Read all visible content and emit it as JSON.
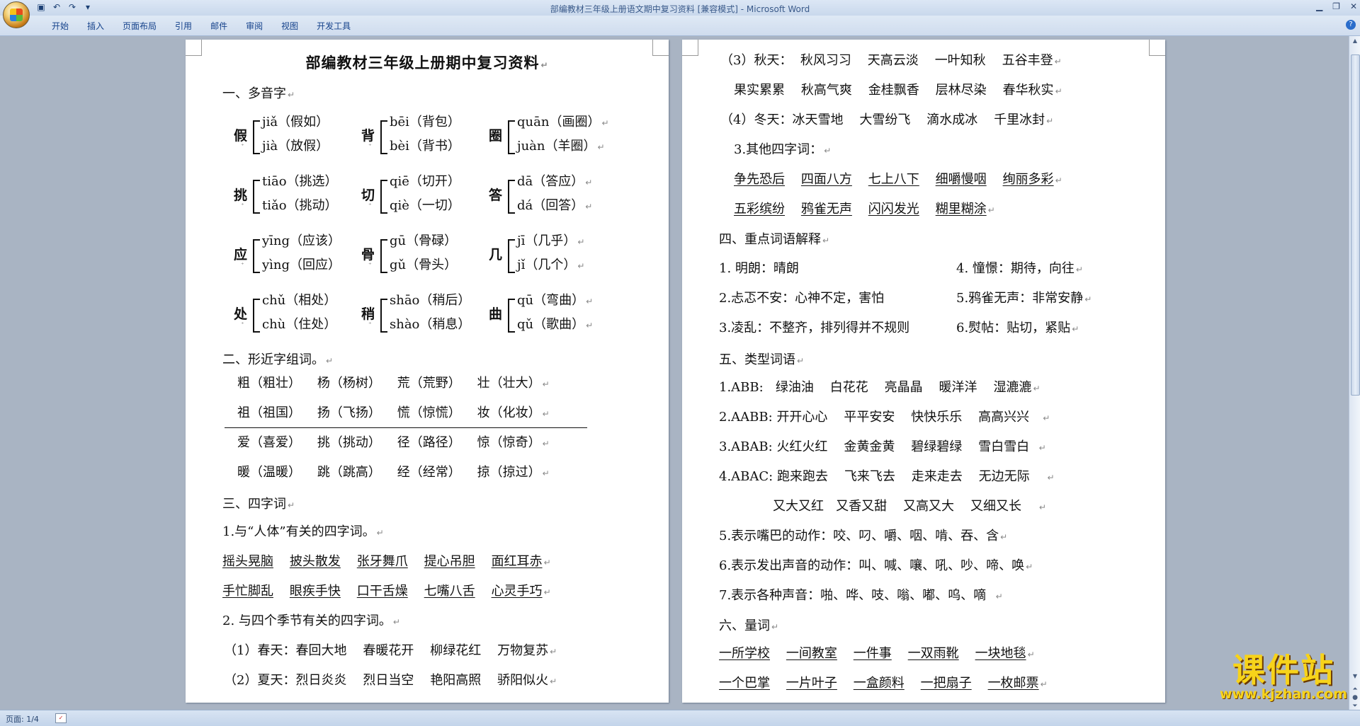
{
  "window": {
    "title": "部编教材三年级上册语文期中复习资料 [兼容模式] - Microsoft Word",
    "controls": [
      "minimize-icon",
      "maximize-icon",
      "close-icon"
    ]
  },
  "quick_access": [
    "save-icon",
    "undo-icon",
    "redo-icon",
    "customize-icon"
  ],
  "ribbon": {
    "tabs": [
      "开始",
      "插入",
      "页面布局",
      "引用",
      "邮件",
      "审阅",
      "视图",
      "开发工具"
    ]
  },
  "status": {
    "page": "页面: 1/4"
  },
  "doc": {
    "title": "部编教材三年级上册期中复习资料",
    "s1": "一、多音字",
    "poly": [
      {
        "ch": "假",
        "r1": "jiǎ（假如）",
        "r2": "jià（放假）"
      },
      {
        "ch": "背",
        "r1": "bēi（背包）",
        "r2": "bèi（背书）"
      },
      {
        "ch": "圈",
        "r1": "quān（画圈）",
        "r2": "juàn（羊圈）"
      },
      {
        "ch": "挑",
        "r1": "tiāo（挑选）",
        "r2": "tiǎo（挑动）"
      },
      {
        "ch": "切",
        "r1": "qiē（切开）",
        "r2": "qiè（一切）"
      },
      {
        "ch": "答",
        "r1": "dā（答应）",
        "r2": "dá（回答）"
      },
      {
        "ch": "应",
        "r1": "yīng（应该）",
        "r2": "yìng（回应）"
      },
      {
        "ch": "骨",
        "r1": "gū（骨碌）",
        "r2": "gǔ（骨头）"
      },
      {
        "ch": "几",
        "r1": "jī（几乎）",
        "r2": "jǐ（几个）"
      },
      {
        "ch": "处",
        "r1": "chǔ（相处）",
        "r2": "chù（住处）"
      },
      {
        "ch": "稍",
        "r1": "shāo（稍后）",
        "r2": "shào（稍息）"
      },
      {
        "ch": "曲",
        "r1": "qū（弯曲）",
        "r2": "qǔ（歌曲）"
      }
    ],
    "s2": "二、形近字组词。",
    "similar": [
      [
        "粗（粗壮）",
        "杨（杨树）",
        "荒（荒野）",
        "壮（壮大）"
      ],
      [
        "祖（祖国）",
        "扬（飞扬）",
        "慌（惊慌）",
        "妆（化妆）"
      ],
      [
        "爱（喜爱）",
        "挑（挑动）",
        "径（路径）",
        "惊（惊奇）"
      ],
      [
        "暖（温暖）",
        "跳（跳高）",
        "经（经常）",
        "掠（掠过）"
      ]
    ],
    "s3": "三、四字词",
    "s3_1": "1.与“人体”有关的四字词。",
    "body_words": [
      [
        "摇头晃脑",
        "披头散发",
        "张牙舞爪",
        "提心吊胆",
        "面红耳赤"
      ],
      [
        "手忙脚乱",
        "眼疾手快",
        "口干舌燥",
        "七嘴八舌",
        "心灵手巧"
      ]
    ],
    "s3_2": "2. 与四个季节有关的四字词。",
    "spring": {
      "label": "（1）春天：",
      "words": [
        "春回大地",
        "春暖花开",
        "柳绿花红",
        "万物复苏"
      ]
    },
    "summer": {
      "label": "（2）夏天：",
      "words": [
        "烈日炎炎",
        "烈日当空",
        "艳阳高照",
        "骄阳似火"
      ]
    },
    "autumn": {
      "label": "（3）秋天：",
      "words": [
        "秋风习习",
        "天高云淡",
        "一叶知秋",
        "五谷丰登"
      ],
      "words2": [
        "果实累累",
        "秋高气爽",
        "金桂飘香",
        "层林尽染",
        "春华秋实"
      ]
    },
    "winter": {
      "label": "（4）冬天：",
      "words": [
        "冰天雪地",
        "大雪纷飞",
        "滴水成冰",
        "千里冰封"
      ]
    },
    "s3_3": "3.其他四字词：",
    "other": [
      [
        "争先恐后",
        "四面八方",
        "七上八下",
        "细嚼慢咽",
        "绚丽多彩"
      ],
      [
        "五彩缤纷",
        "鸦雀无声",
        "闪闪发光",
        "糊里糊涂"
      ]
    ],
    "s4": "四、重点词语解释",
    "explain": [
      [
        "1.  明朗：晴朗",
        "4.  憧憬：期待，向往"
      ],
      [
        "2.忐忑不安：心神不定，害怕",
        "5.鸦雀无声：非常安静"
      ],
      [
        "3.凌乱：不整齐，排列得并不规则",
        "6.熨帖：贴切，紧贴"
      ]
    ],
    "s5": "五、类型词语",
    "types": [
      {
        "label": "1.ABB:",
        "words": [
          "绿油油",
          "白花花",
          "亮晶晶",
          "暖洋洋",
          "湿漉漉"
        ]
      },
      {
        "label": "2.AABB:",
        "words": [
          "开开心心",
          "平平安安",
          "快快乐乐",
          "高高兴兴"
        ]
      },
      {
        "label": "3.ABAB:",
        "words": [
          "火红火红",
          "金黄金黄",
          "碧绿碧绿",
          "雪白雪白"
        ]
      },
      {
        "label": "4.ABAC:",
        "words": [
          "跑来跑去",
          "飞来飞去",
          "走来走去",
          "无边无际"
        ]
      },
      {
        "label": "",
        "words": [
          "又大又红",
          "又香又甜",
          "又高又大",
          "又细又长"
        ]
      }
    ],
    "t5": "5.表示嘴巴的动作：咬、叼、嚼、咽、啃、吞、含",
    "t6": "6.表示发出声音的动作：叫、喊、嚷、吼、吵、啼、唤",
    "t7": "7.表示各种声音：啪、哗、吱、嗡、嘟、呜、嘀",
    "s6": "六、量词",
    "measure": [
      [
        "一所学校",
        "一间教室",
        "一件事",
        "一双雨靴",
        "一块地毯"
      ],
      [
        "一个巴掌",
        "一片叶子",
        "一盒颜料",
        "一把扇子",
        "一枚邮票"
      ]
    ]
  },
  "watermark": {
    "text": "课件站",
    "url": "www.kjzhan.com"
  }
}
